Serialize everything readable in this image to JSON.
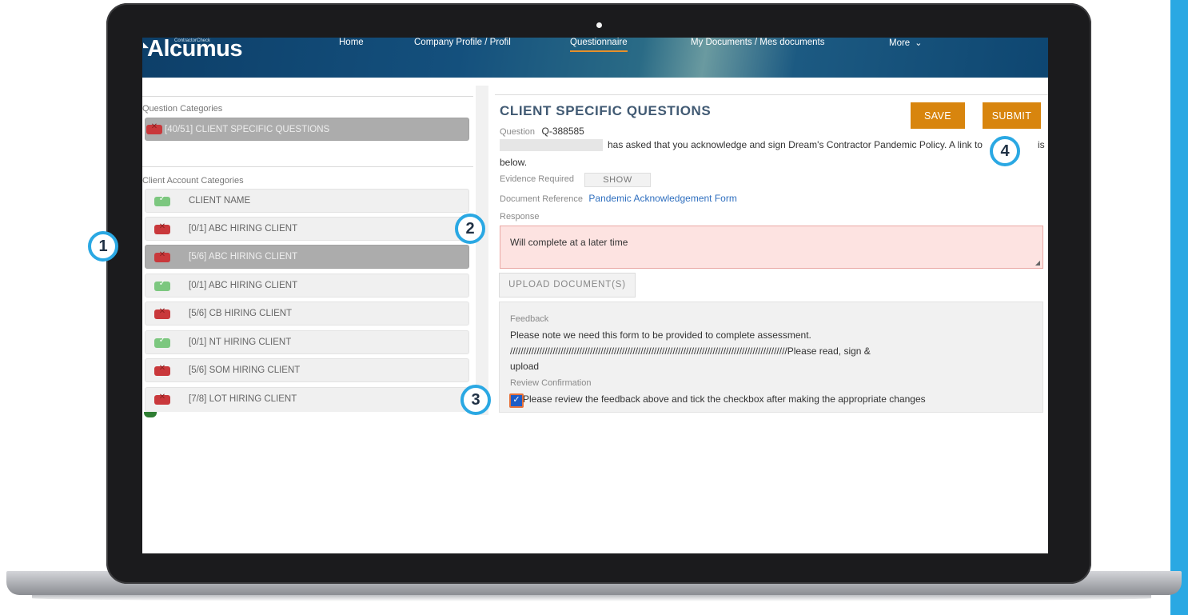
{
  "header": {
    "logo": "Alcumus",
    "logo_sub": "ContractorCheck",
    "nav": [
      {
        "label": "Home"
      },
      {
        "label": "Company Profile / Profil"
      },
      {
        "label": "Questionnaire",
        "active": true
      },
      {
        "label": "My Documents / Mes documents"
      },
      {
        "label": "More"
      }
    ]
  },
  "left_panel": {
    "question_categories_heading": "Question Categories",
    "question_categories": [
      {
        "label": "[40/51] CLIENT SPECIFIC QUESTIONS",
        "status": "incomplete",
        "selected": true
      }
    ],
    "client_account_heading": "Client Account Categories",
    "client_accounts": [
      {
        "label": "CLIENT NAME",
        "status": "complete"
      },
      {
        "label": "[0/1] ABC HIRING CLIENT",
        "status": "incomplete"
      },
      {
        "label": "[5/6] ABC HIRING CLIENT",
        "status": "incomplete",
        "selected": true
      },
      {
        "label": "[0/1] ABC HIRING CLIENT",
        "status": "complete"
      },
      {
        "label": "[5/6] CB HIRING CLIENT",
        "status": "incomplete"
      },
      {
        "label": "[0/1] NT HIRING CLIENT",
        "status": "complete"
      },
      {
        "label": "[5/6] SOM HIRING CLIENT",
        "status": "incomplete"
      },
      {
        "label": "[7/8] LOT HIRING CLIENT",
        "status": "incomplete"
      }
    ]
  },
  "question": {
    "title": "CLIENT SPECIFIC QUESTIONS",
    "save_label": "SAVE",
    "submit_label": "SUBMIT",
    "question_label": "Question",
    "question_id": "Q-388585",
    "text_line1": "has asked that you acknowledge and sign Dream's Contractor Pandemic Policy. A link to",
    "text_line1_end": "is",
    "text_line2": "below.",
    "evidence_label": "Evidence Required",
    "show_label": "SHOW",
    "doc_ref_label": "Document Reference",
    "doc_ref_link": "Pandemic Acknowledgement Form",
    "response_label": "Response",
    "response_value": "Will complete at a later time",
    "upload_label": "UPLOAD DOCUMENT(S)",
    "feedback_label": "Feedback",
    "feedback_line1": "Please note we need this form to be provided to complete assessment.",
    "feedback_line2": "////////////////////////////////////////////////////////////////////////////////////////////////////////Please read, sign &",
    "feedback_line3": "upload",
    "review_label": "Review Confirmation",
    "review_text": "Please review the feedback above and tick the checkbox after making the appropriate changes"
  },
  "callouts": [
    "1",
    "2",
    "3",
    "4"
  ],
  "colors": {
    "accent_blue": "#2aa8e3",
    "button_orange": "#d8850e",
    "status_red": "#c9383b",
    "status_green": "#7cc77f",
    "title_color": "#415a73"
  }
}
